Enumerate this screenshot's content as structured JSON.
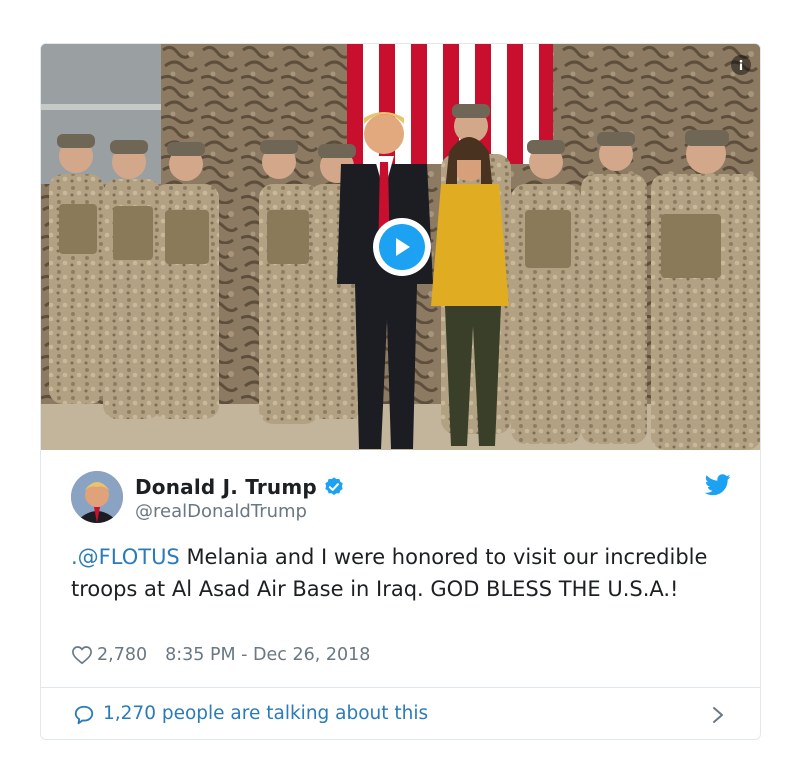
{
  "tweet": {
    "author": {
      "display_name": "Donald J. Trump",
      "handle": "@realDonaldTrump",
      "verified": true
    },
    "text": {
      "mention": ".@FLOTUS",
      "body": " Melania and I were honored to visit our incredible troops at Al Asad Air Base in Iraq. GOD BLESS THE U.S.A.!"
    },
    "likes": "2,780",
    "timestamp": "8:35 PM - Dec 26, 2018",
    "talking": "1,270 people are talking about this"
  },
  "media": {
    "type": "video",
    "play_icon": "play-icon",
    "info_icon": "info-icon"
  },
  "icons": {
    "verified": "verified-badge-icon",
    "brand": "twitter-bird-icon",
    "like": "heart-icon",
    "reply": "speech-bubble-icon",
    "more": "chevron-right-icon"
  },
  "colors": {
    "brand_blue": "#1da1f2",
    "link_blue": "#2b7bb9",
    "text": "#1c2022",
    "muted": "#697882",
    "border": "#e1e8ed"
  }
}
